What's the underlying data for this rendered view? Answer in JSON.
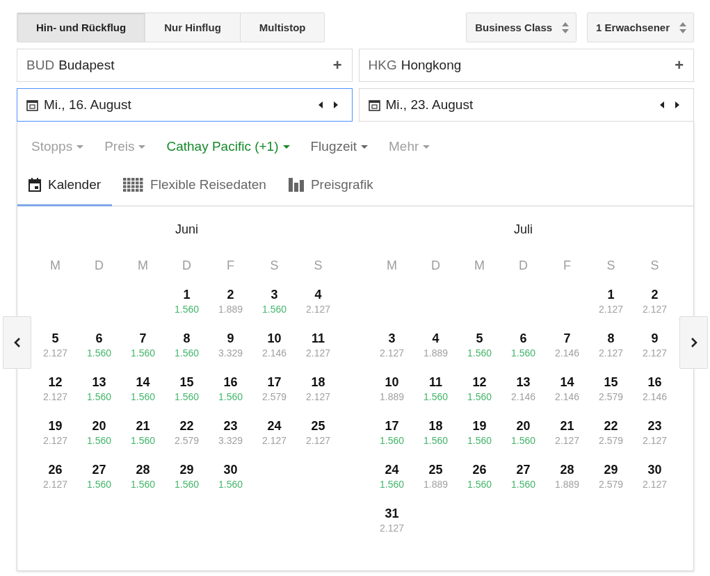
{
  "trip_types": [
    {
      "label": "Hin- und Rückflug",
      "selected": true
    },
    {
      "label": "Nur Hinflug",
      "selected": false
    },
    {
      "label": "Multistop",
      "selected": false
    }
  ],
  "selectors": [
    {
      "label": "Business Class"
    },
    {
      "label": "1 Erwachsener"
    }
  ],
  "airports": [
    {
      "code": "BUD",
      "city": "Budapest",
      "action": "+"
    },
    {
      "code": "HKG",
      "city": "Hongkong",
      "action": "+"
    }
  ],
  "dates": [
    {
      "value": "Mi., 16. August",
      "focused": true
    },
    {
      "value": "Mi., 23. August",
      "focused": false
    }
  ],
  "filters": [
    {
      "label": "Stopps",
      "kind": "disabled"
    },
    {
      "label": "Preis",
      "kind": "disabled"
    },
    {
      "label": "Cathay Pacific (+1)",
      "kind": "applied"
    },
    {
      "label": "Flugzeit",
      "kind": "normal"
    },
    {
      "label": "Mehr",
      "kind": "disabled"
    }
  ],
  "view_tabs": [
    {
      "label": "Kalender",
      "selected": true
    },
    {
      "label": "Flexible Reisedaten",
      "selected": false
    },
    {
      "label": "Preisgrafik",
      "selected": false
    }
  ],
  "months": [
    {
      "name": "Juni",
      "weekdays": [
        "M",
        "D",
        "M",
        "D",
        "F",
        "S",
        "S"
      ],
      "weeks": [
        [
          {
            "day": "1",
            "price": "1.560",
            "cheap": true
          },
          {
            "day": "2",
            "price": "1.889",
            "cheap": false
          },
          {
            "day": "3",
            "price": "1.560",
            "cheap": true
          },
          {
            "day": "4",
            "price": "2.127",
            "cheap": false
          }
        ],
        [
          {
            "day": "5",
            "price": "2.127",
            "cheap": false
          },
          {
            "day": "6",
            "price": "1.560",
            "cheap": true
          },
          {
            "day": "7",
            "price": "1.560",
            "cheap": true
          },
          {
            "day": "8",
            "price": "1.560",
            "cheap": true
          },
          {
            "day": "9",
            "price": "3.329",
            "cheap": false
          },
          {
            "day": "10",
            "price": "2.146",
            "cheap": false
          },
          {
            "day": "11",
            "price": "2.127",
            "cheap": false
          }
        ],
        [
          {
            "day": "12",
            "price": "2.127",
            "cheap": false
          },
          {
            "day": "13",
            "price": "1.560",
            "cheap": true
          },
          {
            "day": "14",
            "price": "1.560",
            "cheap": true
          },
          {
            "day": "15",
            "price": "1.560",
            "cheap": true
          },
          {
            "day": "16",
            "price": "1.560",
            "cheap": true
          },
          {
            "day": "17",
            "price": "2.579",
            "cheap": false
          },
          {
            "day": "18",
            "price": "2.127",
            "cheap": false
          }
        ],
        [
          {
            "day": "19",
            "price": "2.127",
            "cheap": false
          },
          {
            "day": "20",
            "price": "1.560",
            "cheap": true
          },
          {
            "day": "21",
            "price": "1.560",
            "cheap": true
          },
          {
            "day": "22",
            "price": "2.579",
            "cheap": false
          },
          {
            "day": "23",
            "price": "3.329",
            "cheap": false
          },
          {
            "day": "24",
            "price": "2.127",
            "cheap": false
          },
          {
            "day": "25",
            "price": "2.127",
            "cheap": false
          }
        ],
        [
          {
            "day": "26",
            "price": "2.127",
            "cheap": false
          },
          {
            "day": "27",
            "price": "1.560",
            "cheap": true
          },
          {
            "day": "28",
            "price": "1.560",
            "cheap": true
          },
          {
            "day": "29",
            "price": "1.560",
            "cheap": true
          },
          {
            "day": "30",
            "price": "1.560",
            "cheap": true
          }
        ]
      ]
    },
    {
      "name": "Juli",
      "weekdays": [
        "M",
        "D",
        "M",
        "D",
        "F",
        "S",
        "S"
      ],
      "weeks": [
        [
          {
            "day": "1",
            "price": "2.127",
            "cheap": false
          },
          {
            "day": "2",
            "price": "2.127",
            "cheap": false
          }
        ],
        [
          {
            "day": "3",
            "price": "2.127",
            "cheap": false
          },
          {
            "day": "4",
            "price": "1.889",
            "cheap": false
          },
          {
            "day": "5",
            "price": "1.560",
            "cheap": true
          },
          {
            "day": "6",
            "price": "1.560",
            "cheap": true
          },
          {
            "day": "7",
            "price": "2.146",
            "cheap": false
          },
          {
            "day": "8",
            "price": "2.127",
            "cheap": false
          },
          {
            "day": "9",
            "price": "2.127",
            "cheap": false
          }
        ],
        [
          {
            "day": "10",
            "price": "1.889",
            "cheap": false
          },
          {
            "day": "11",
            "price": "1.560",
            "cheap": true
          },
          {
            "day": "12",
            "price": "1.560",
            "cheap": true
          },
          {
            "day": "13",
            "price": "2.146",
            "cheap": false
          },
          {
            "day": "14",
            "price": "2.146",
            "cheap": false
          },
          {
            "day": "15",
            "price": "2.579",
            "cheap": false
          },
          {
            "day": "16",
            "price": "2.146",
            "cheap": false
          }
        ],
        [
          {
            "day": "17",
            "price": "1.560",
            "cheap": true
          },
          {
            "day": "18",
            "price": "1.560",
            "cheap": true
          },
          {
            "day": "19",
            "price": "1.560",
            "cheap": true
          },
          {
            "day": "20",
            "price": "1.560",
            "cheap": true
          },
          {
            "day": "21",
            "price": "2.127",
            "cheap": false
          },
          {
            "day": "22",
            "price": "2.579",
            "cheap": false
          },
          {
            "day": "23",
            "price": "2.127",
            "cheap": false
          }
        ],
        [
          {
            "day": "24",
            "price": "1.560",
            "cheap": true
          },
          {
            "day": "25",
            "price": "1.889",
            "cheap": false
          },
          {
            "day": "26",
            "price": "1.560",
            "cheap": true
          },
          {
            "day": "27",
            "price": "1.560",
            "cheap": true
          },
          {
            "day": "28",
            "price": "1.889",
            "cheap": false
          },
          {
            "day": "29",
            "price": "2.579",
            "cheap": false
          },
          {
            "day": "30",
            "price": "2.127",
            "cheap": false
          }
        ],
        [
          {
            "day": "31",
            "price": "2.127",
            "cheap": false
          }
        ]
      ]
    }
  ]
}
